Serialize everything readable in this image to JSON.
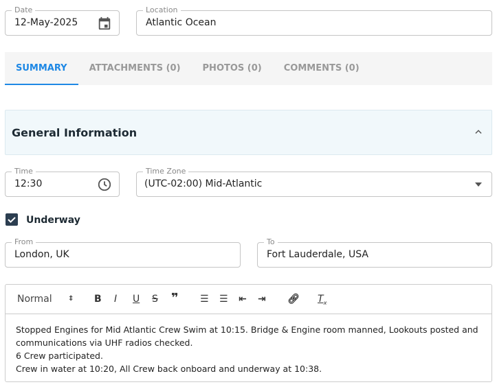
{
  "date": {
    "label": "Date",
    "value": "12-May-2025"
  },
  "location": {
    "label": "Location",
    "value": "Atlantic Ocean"
  },
  "tabs": [
    {
      "label": "SUMMARY"
    },
    {
      "label": "ATTACHMENTS (0)"
    },
    {
      "label": "PHOTOS (0)"
    },
    {
      "label": "COMMENTS (0)"
    }
  ],
  "panel": {
    "title": "General Information"
  },
  "time": {
    "label": "Time",
    "value": "12:30"
  },
  "timezone": {
    "label": "Time Zone",
    "value": "(UTC-02:00) Mid-Atlantic"
  },
  "underway": {
    "label": "Underway",
    "checked": true
  },
  "from": {
    "label": "From",
    "value": "London, UK"
  },
  "to": {
    "label": "To",
    "value": "Fort Lauderdale, USA"
  },
  "editor": {
    "format": "Normal",
    "lines": [
      "Stopped Engines for Mid Atlantic Crew Swim at 10:15. Bridge & Engine room manned, Lookouts posted and communications via UHF radios checked.",
      "6 Crew participated.",
      "Crew in water at 10:20,  All Crew back onboard and underway at 10:38."
    ]
  },
  "colors": {
    "accent": "#1e88e5",
    "panel": "#f1f8fb"
  }
}
